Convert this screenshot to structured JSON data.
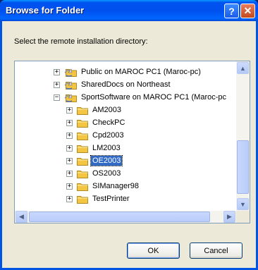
{
  "window": {
    "title": "Browse for Folder"
  },
  "titlebar": {
    "help_glyph": "?",
    "close_glyph": "✕"
  },
  "prompt": "Select the remote installation directory:",
  "tree": {
    "items": [
      {
        "label": "Public on MAROC PC1 (Maroc-pc)",
        "type": "share",
        "expander": "+",
        "selected": false
      },
      {
        "label": "SharedDocs on Northeast",
        "type": "share",
        "expander": "+",
        "selected": false
      },
      {
        "label": "SportSoftware on MAROC PC1 (Maroc-pc",
        "type": "share",
        "expander": "−",
        "selected": false
      },
      {
        "label": "AM2003",
        "type": "folder",
        "expander": "+",
        "selected": false
      },
      {
        "label": "CheckPC",
        "type": "folder",
        "expander": "+",
        "selected": false
      },
      {
        "label": "Cpd2003",
        "type": "folder",
        "expander": "+",
        "selected": false
      },
      {
        "label": "LM2003",
        "type": "folder",
        "expander": "+",
        "selected": false
      },
      {
        "label": "OE2003",
        "type": "folder",
        "expander": "+",
        "selected": true
      },
      {
        "label": "OS2003",
        "type": "folder",
        "expander": "+",
        "selected": false
      },
      {
        "label": "SIManager98",
        "type": "folder",
        "expander": "+",
        "selected": false
      },
      {
        "label": "TestPrinter",
        "type": "folder",
        "expander": "+",
        "selected": false
      }
    ]
  },
  "scroll_glyphs": {
    "up": "▲",
    "down": "▼",
    "left": "◀",
    "right": "▶"
  },
  "buttons": {
    "ok": "OK",
    "cancel": "Cancel"
  },
  "colors": {
    "title_bar": "#0054e3",
    "selection": "#316ac5",
    "folder": "#f4c542"
  }
}
